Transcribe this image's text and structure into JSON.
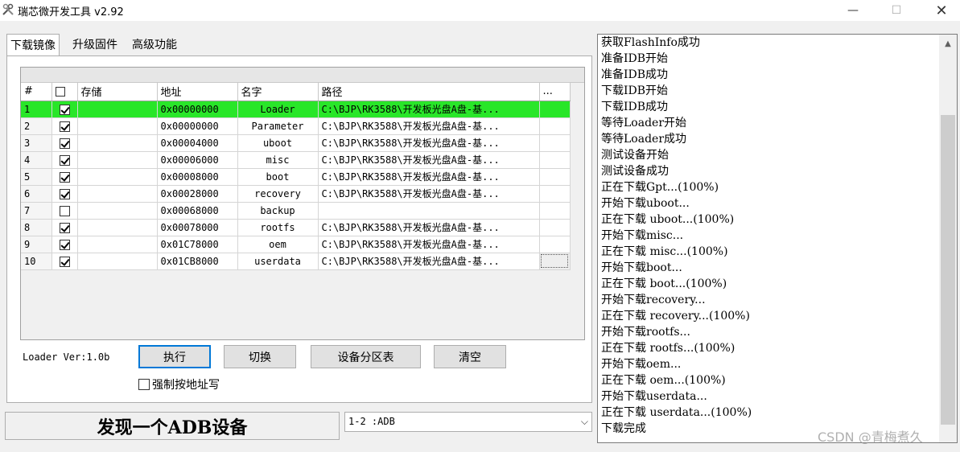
{
  "window": {
    "title": "瑞芯微开发工具 v2.92",
    "minimize": "—",
    "maximize": "☐",
    "close": "✕"
  },
  "tabs": [
    {
      "label": "下载镜像",
      "active": true
    },
    {
      "label": "升级固件",
      "active": false
    },
    {
      "label": "高级功能",
      "active": false
    }
  ],
  "table": {
    "headers": {
      "num": "#",
      "store": "存储",
      "addr": "地址",
      "name": "名字",
      "path": "路径",
      "more": "..."
    },
    "rows": [
      {
        "num": "1",
        "checked": true,
        "addr": "0x00000000",
        "name": "Loader",
        "path": "C:\\BJP\\RK3588\\开发板光盘A盘-基...",
        "selected": true
      },
      {
        "num": "2",
        "checked": true,
        "addr": "0x00000000",
        "name": "Parameter",
        "path": "C:\\BJP\\RK3588\\开发板光盘A盘-基..."
      },
      {
        "num": "3",
        "checked": true,
        "addr": "0x00004000",
        "name": "uboot",
        "path": "C:\\BJP\\RK3588\\开发板光盘A盘-基..."
      },
      {
        "num": "4",
        "checked": true,
        "addr": "0x00006000",
        "name": "misc",
        "path": "C:\\BJP\\RK3588\\开发板光盘A盘-基..."
      },
      {
        "num": "5",
        "checked": true,
        "addr": "0x00008000",
        "name": "boot",
        "path": "C:\\BJP\\RK3588\\开发板光盘A盘-基..."
      },
      {
        "num": "6",
        "checked": true,
        "addr": "0x00028000",
        "name": "recovery",
        "path": "C:\\BJP\\RK3588\\开发板光盘A盘-基..."
      },
      {
        "num": "7",
        "checked": false,
        "addr": "0x00068000",
        "name": "backup",
        "path": ""
      },
      {
        "num": "8",
        "checked": true,
        "addr": "0x00078000",
        "name": "rootfs",
        "path": "C:\\BJP\\RK3588\\开发板光盘A盘-基..."
      },
      {
        "num": "9",
        "checked": true,
        "addr": "0x01C78000",
        "name": "oem",
        "path": "C:\\BJP\\RK3588\\开发板光盘A盘-基..."
      },
      {
        "num": "10",
        "checked": true,
        "addr": "0x01CB8000",
        "name": "userdata",
        "path": "C:\\BJP\\RK3588\\开发板光盘A盘-基...",
        "focus_more": true
      }
    ]
  },
  "loader_version": "Loader Ver:1.0b",
  "buttons": {
    "run": "执行",
    "switch": "切换",
    "partition_table": "设备分区表",
    "clear": "清空"
  },
  "force_address_write": {
    "label": "强制按地址写",
    "checked": false
  },
  "status": "发现一个ADB设备",
  "device_select": {
    "value": "1-2 :ADB",
    "arrow": "⌵"
  },
  "log": [
    "获取FlashInfo成功",
    "准备IDB开始",
    "准备IDB成功",
    "下载IDB开始",
    "下载IDB成功",
    "等待Loader开始",
    "等待Loader成功",
    "测试设备开始",
    "测试设备成功",
    "正在下载Gpt...(100%)",
    "开始下载uboot...",
    "正在下载 uboot...(100%)",
    "开始下载misc...",
    "正在下载 misc...(100%)",
    "开始下载boot...",
    "正在下载 boot...(100%)",
    "开始下载recovery...",
    "正在下载 recovery...(100%)",
    "开始下载rootfs...",
    "正在下载 rootfs...(100%)",
    "开始下载oem...",
    "正在下载 oem...(100%)",
    "开始下载userdata...",
    "正在下载 userdata...(100%)",
    "下载完成"
  ],
  "scroll_up": "▲",
  "watermark": "CSDN @青梅煮久"
}
